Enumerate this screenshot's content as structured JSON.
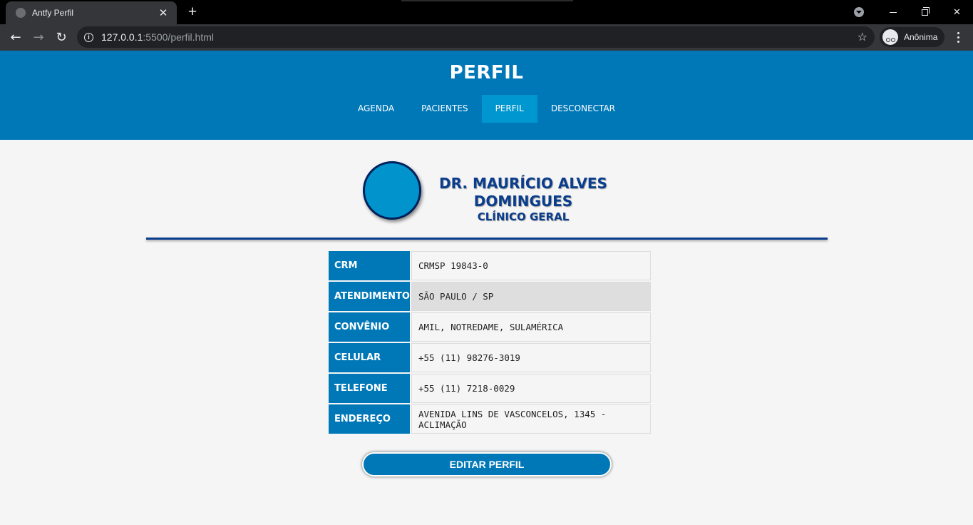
{
  "browser": {
    "tab_title": "Antfy Perfil",
    "tab_close": "✕",
    "new_tab": "+",
    "url_host": "127.0.0.1",
    "url_rest": ":5500/perfil.html",
    "profile_label": "Anônima",
    "back": "←",
    "forward": "→",
    "reload": "↻",
    "star": "☆"
  },
  "header": {
    "title": "PERFIL",
    "nav": [
      {
        "label": "AGENDA"
      },
      {
        "label": "PACIENTES"
      },
      {
        "label": "PERFIL"
      },
      {
        "label": "DESCONECTAR"
      }
    ]
  },
  "profile": {
    "name_line1": "DR. MAURÍCIO ALVES",
    "name_line2": "DOMINGUES",
    "specialty": "CLÍNICO GERAL",
    "rows": [
      {
        "label": "CRM",
        "value": "CRMSP 19843-0"
      },
      {
        "label": "ATENDIMENTO",
        "value": "SÃO PAULO / SP"
      },
      {
        "label": "CONVÊNIO",
        "value": "AMIL, NOTREDAME, SULAMÉRICA"
      },
      {
        "label": "CELULAR",
        "value": "+55 (11) 98276-3019"
      },
      {
        "label": "TELEFONE",
        "value": "+55 (11) 7218-0029"
      },
      {
        "label": "ENDEREÇO",
        "value": "AVENIDA LINS DE VASCONCELOS, 1345 - ACLIMAÇÃO"
      }
    ],
    "edit_button": "EDITAR PERFIL"
  }
}
